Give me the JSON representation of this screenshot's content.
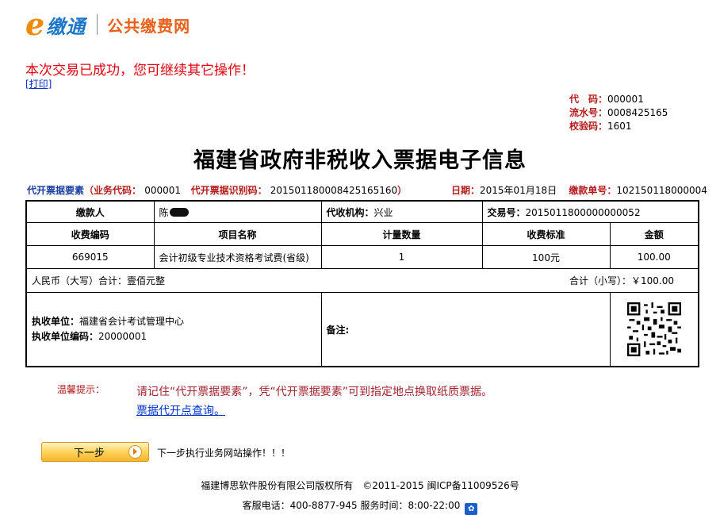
{
  "header": {
    "logo_e": "e",
    "logo_jiaotong": "缴通",
    "logo_public": "公共缴费网"
  },
  "status": {
    "success_message": "本次交易已成功，您可继续其它操作！",
    "print_link": "[打印]"
  },
  "codes": {
    "code_label": "代　码：",
    "code_value": "000001",
    "serial_label": "流水号：",
    "serial_value": "0008425165",
    "check_label": "校验码：",
    "check_value": "1601"
  },
  "title": "福建省政府非税收入票据电子信息",
  "meta": {
    "elements_label": "代开票据要素",
    "business_code_label": "（业务代码：",
    "business_code": "000001",
    "identifier_label": "代开票据识别码：",
    "identifier": "201501180008425165160",
    "identifier_close": "）",
    "date_label": "日期：",
    "date": "2015年01月18日",
    "payment_no_label": "缴款单号：",
    "payment_no": "102150118000004"
  },
  "receipt": {
    "payer_label": "缴款人",
    "payer_name": "陈",
    "agency_label": "代收机构：",
    "agency": "兴业",
    "txn_label": "交易号：",
    "txn_no": "2015011800000000052",
    "headers": [
      "收费编码",
      "项目名称",
      "计量数量",
      "收费标准",
      "金额"
    ],
    "item": {
      "code": "669015",
      "name": "会计初级专业技术资格考试费(省级)",
      "quantity": "1",
      "standard": "100元",
      "amount": "100.00"
    },
    "total_upper_label": "人民币（大写）合计：",
    "total_upper": "壹佰元整",
    "total_lower_label": "合计（小写）：",
    "total_lower": "￥100.00",
    "exec_unit_label": "执收单位：",
    "exec_unit": "福建省会计考试管理中心",
    "exec_code_label": "执收单位编码：",
    "exec_code": "20000001",
    "remark_label": "备注:"
  },
  "tips": {
    "label": "温馨提示：",
    "text": "请记住“代开票据要素”，凭“代开票据要素”可到指定地点换取纸质票据。",
    "link": "票据代开点查询。"
  },
  "actions": {
    "next_label": "下一步",
    "next_hint": "下一步执行业务网站操作！！！"
  },
  "footer": {
    "copyright": "福建博思软件股份有限公司版权所有　©2011-2015 闽ICP备11009526号",
    "hotline": "客服电话：400-8877-945 服务时间：8:00-22:00"
  },
  "colors": {
    "success_red": "#e60012",
    "label_red": "#b31b1b",
    "link_blue": "#0033cc",
    "logo_orange": "#f08a00",
    "logo_blue": "#1a76c9"
  }
}
